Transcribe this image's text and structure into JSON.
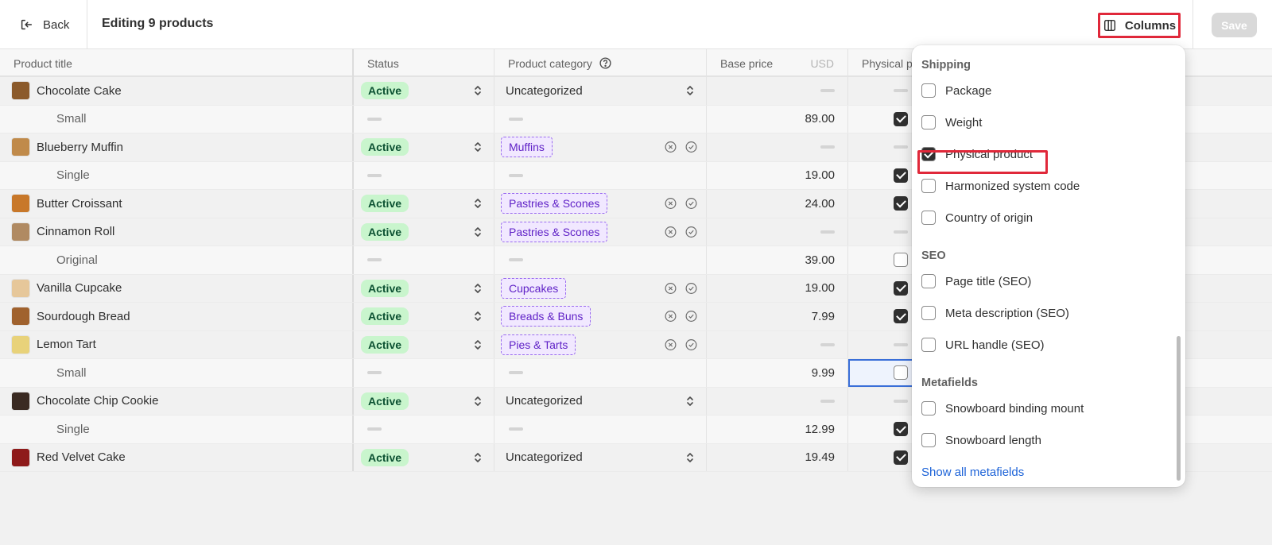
{
  "header": {
    "back_label": "Back",
    "title": "Editing 9 products",
    "columns_label": "Columns",
    "save_label": "Save"
  },
  "table": {
    "headers": {
      "title": "Product title",
      "status": "Status",
      "category": "Product category",
      "base_price": "Base price",
      "currency": "USD",
      "physical": "Physical p"
    }
  },
  "rows": [
    {
      "type": "product",
      "title": "Chocolate Cake",
      "status": "Active",
      "category": "Uncategorized",
      "category_kind": "plain",
      "price": "",
      "physical": null,
      "thumb": "#8b5a2b"
    },
    {
      "type": "variant",
      "title": "Small",
      "price": "89.00",
      "physical": true
    },
    {
      "type": "product",
      "title": "Blueberry Muffin",
      "status": "Active",
      "category": "Muffins",
      "category_kind": "tag",
      "price": "",
      "physical": null,
      "thumb": "#c08a4a"
    },
    {
      "type": "variant",
      "title": "Single",
      "price": "19.00",
      "physical": true
    },
    {
      "type": "product",
      "title": "Butter Croissant",
      "status": "Active",
      "category": "Pastries & Scones",
      "category_kind": "tag",
      "price": "24.00",
      "physical": true,
      "thumb": "#c8782a"
    },
    {
      "type": "product",
      "title": "Cinnamon Roll",
      "status": "Active",
      "category": "Pastries & Scones",
      "category_kind": "tag",
      "price": "",
      "physical": null,
      "thumb": "#b08a62"
    },
    {
      "type": "variant",
      "title": "Original",
      "price": "39.00",
      "physical": false
    },
    {
      "type": "product",
      "title": "Vanilla Cupcake",
      "status": "Active",
      "category": "Cupcakes",
      "category_kind": "tag",
      "price": "19.00",
      "physical": true,
      "thumb": "#e6c79a"
    },
    {
      "type": "product",
      "title": "Sourdough Bread",
      "status": "Active",
      "category": "Breads & Buns",
      "category_kind": "tag",
      "price": "7.99",
      "physical": true,
      "thumb": "#a0622e"
    },
    {
      "type": "product",
      "title": "Lemon Tart",
      "status": "Active",
      "category": "Pies & Tarts",
      "category_kind": "tag",
      "price": "",
      "physical": null,
      "thumb": "#e8d27a"
    },
    {
      "type": "variant",
      "title": "Small",
      "price": "9.99",
      "physical": false,
      "selected": true
    },
    {
      "type": "product",
      "title": "Chocolate Chip Cookie",
      "status": "Active",
      "category": "Uncategorized",
      "category_kind": "plain",
      "price": "",
      "physical": null,
      "thumb": "#3a2a22"
    },
    {
      "type": "variant",
      "title": "Single",
      "price": "12.99",
      "physical": true
    },
    {
      "type": "product",
      "title": "Red Velvet Cake",
      "status": "Active",
      "category": "Uncategorized",
      "category_kind": "plain",
      "price": "19.49",
      "physical": true,
      "thumb": "#8e1a1a"
    }
  ],
  "columns_popover": {
    "sections": [
      {
        "label": "Shipping",
        "items": [
          {
            "label": "Package",
            "checked": false
          },
          {
            "label": "Weight",
            "checked": false
          },
          {
            "label": "Physical product",
            "checked": true
          },
          {
            "label": "Harmonized system code",
            "checked": false
          },
          {
            "label": "Country of origin",
            "checked": false
          }
        ]
      },
      {
        "label": "SEO",
        "items": [
          {
            "label": "Page title (SEO)",
            "checked": false
          },
          {
            "label": "Meta description (SEO)",
            "checked": false
          },
          {
            "label": "URL handle (SEO)",
            "checked": false
          }
        ]
      },
      {
        "label": "Metafields",
        "items": [
          {
            "label": "Snowboard binding mount",
            "checked": false
          },
          {
            "label": "Snowboard length",
            "checked": false
          }
        ]
      }
    ],
    "show_all_label": "Show all metafields"
  }
}
